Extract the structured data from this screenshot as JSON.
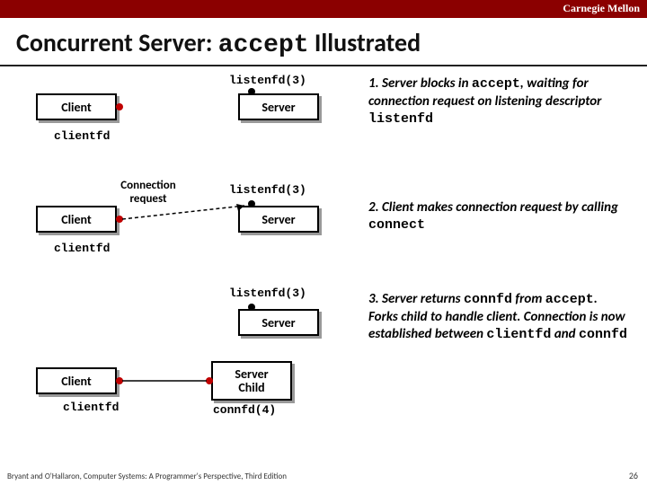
{
  "brand": "Carnegie Mellon",
  "title_pre": "Concurrent Server: ",
  "title_mono": "accept",
  "title_post": " Illustrated",
  "row1": {
    "listenfd": "listenfd(3)",
    "client": "Client",
    "server": "Server",
    "clientfd": "clientfd"
  },
  "row2": {
    "connreq": "Connection\nrequest",
    "listenfd": "listenfd(3)",
    "client": "Client",
    "server": "Server",
    "clientfd": "clientfd"
  },
  "row3": {
    "listenfd": "listenfd(3)",
    "client": "Client",
    "server": "Server",
    "serverchild": "Server\nChild",
    "clientfd": "clientfd",
    "connfd": "connfd(4)"
  },
  "caption1_a": "1. Server blocks in ",
  "caption1_b": "accept",
  "caption1_c": ", waiting for connection request on listening descriptor ",
  "caption1_d": "listenfd",
  "caption2_a": "2. Client makes connection request by calling ",
  "caption2_b": "connect",
  "caption3_a": "3. Server returns ",
  "caption3_b": "connfd",
  "caption3_c": " from ",
  "caption3_d": "accept",
  "caption3_e": ". Forks child to handle client.  Connection is now established between ",
  "caption3_f": "clientfd",
  "caption3_g": " and ",
  "caption3_h": "connfd",
  "footer": "Bryant and O'Hallaron, Computer Systems: A Programmer's Perspective, Third Edition",
  "page": "26"
}
